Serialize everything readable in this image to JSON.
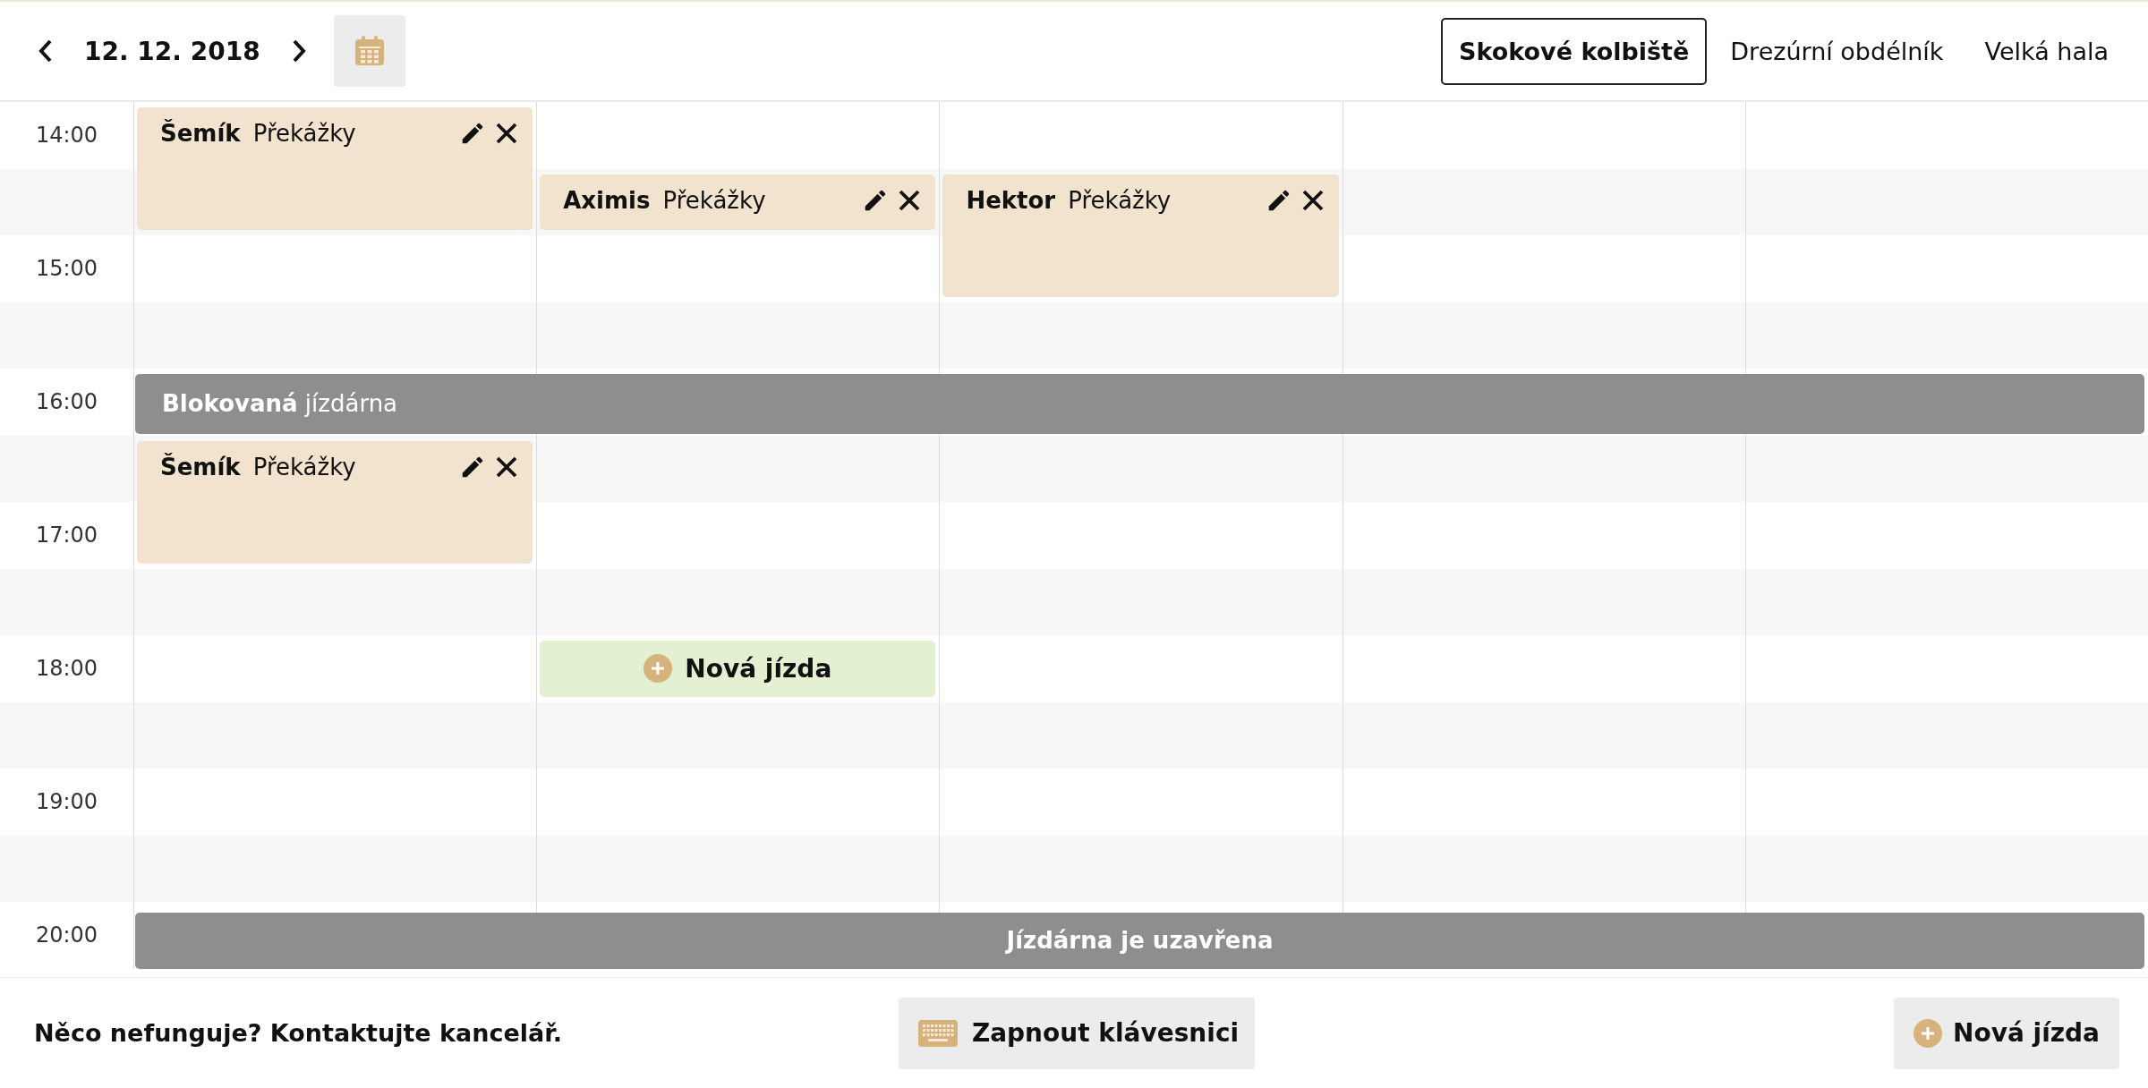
{
  "header": {
    "date": "12. 12. 2018"
  },
  "tabs": [
    {
      "label": "Skokové kolbiště",
      "selected": true
    },
    {
      "label": "Drezúrní obdélník",
      "selected": false
    },
    {
      "label": "Velká hala",
      "selected": false
    }
  ],
  "schedule": {
    "hours": [
      "14:00",
      "15:00",
      "16:00",
      "17:00",
      "18:00",
      "19:00",
      "20:00"
    ],
    "events": [
      {
        "kind": "ride",
        "horse": "Šemík",
        "discipline": "Překážky"
      },
      {
        "kind": "ride",
        "horse": "Aximis",
        "discipline": "Překážky"
      },
      {
        "kind": "ride",
        "horse": "Hektor",
        "discipline": "Překážky"
      },
      {
        "kind": "blocked",
        "text": "**Blokovaná** jízdárna"
      },
      {
        "kind": "ride",
        "horse": "Šemík",
        "discipline": "Překážky"
      },
      {
        "kind": "new",
        "label": "Nová jízda"
      },
      {
        "kind": "closed",
        "label": "Jízdárna je uzavřena"
      }
    ]
  },
  "footer": {
    "help_text": "Něco nefunguje? Kontaktujte kancelář.",
    "keyboard_button": "Zapnout klávesnici",
    "new_ride_button": "Nová jízda"
  }
}
